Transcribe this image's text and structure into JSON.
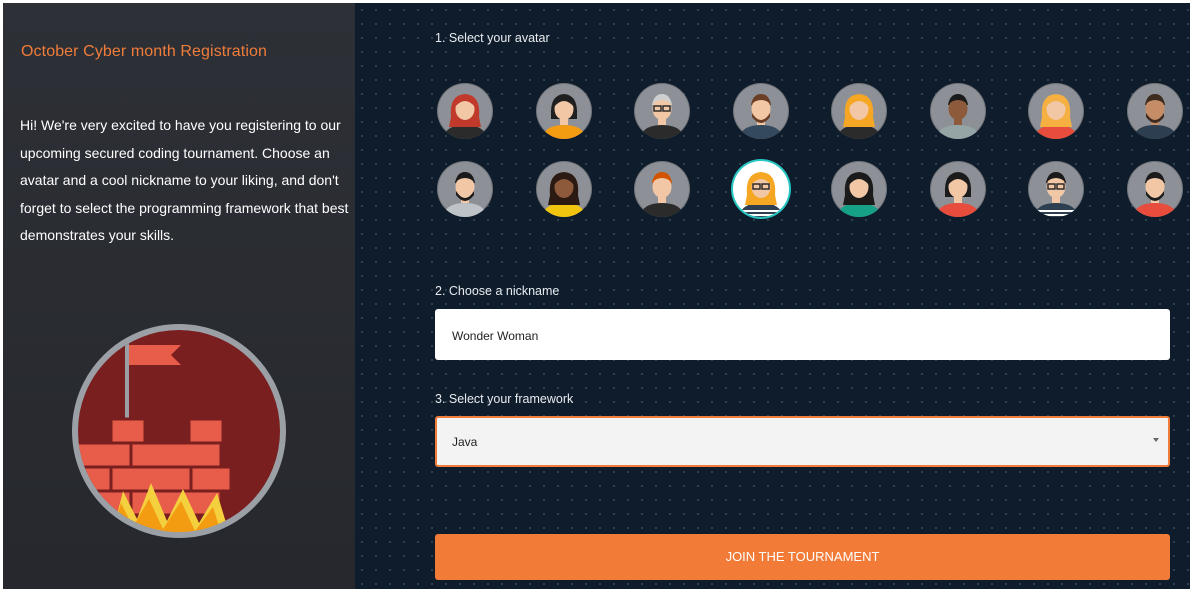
{
  "intro": {
    "title": "October Cyber month Registration",
    "text": "Hi! We're very excited to have you registering to our upcoming secured coding tournament. Choose an avatar and a cool nickname to your liking, and don't forget to select the programming framework that best demonstrates your skills."
  },
  "form": {
    "step1_label": "1. Select your avatar",
    "step2_label": "2. Choose a nickname",
    "nickname_value": "Wonder Woman",
    "step3_label": "3. Select your framework",
    "framework_selected": "Java",
    "submit_label": "JOIN THE TOURNAMENT"
  },
  "avatars": [
    {
      "id": "avatar-1",
      "hair": "#c0392b",
      "shirt": "#2b2b2b",
      "skin": "#f1c7a5",
      "style": "long",
      "selected": false
    },
    {
      "id": "avatar-2",
      "hair": "#1f1f1f",
      "shirt": "#f39c12",
      "skin": "#f1c7a5",
      "style": "bob",
      "selected": false
    },
    {
      "id": "avatar-3",
      "hair": "#cfcfcf",
      "shirt": "#2b2b2b",
      "skin": "#f1c7a5",
      "style": "short",
      "glasses": true,
      "selected": false
    },
    {
      "id": "avatar-4",
      "hair": "#6b3e26",
      "shirt": "#34495e",
      "skin": "#f1c7a5",
      "style": "beard",
      "selected": false
    },
    {
      "id": "avatar-5",
      "hair": "#f5a623",
      "shirt": "#2b2b2b",
      "skin": "#f1c7a5",
      "style": "long",
      "selected": false
    },
    {
      "id": "avatar-6",
      "hair": "#1b1b1b",
      "shirt": "#95a5a6",
      "skin": "#8d5a3b",
      "style": "short",
      "selected": false
    },
    {
      "id": "avatar-7",
      "hair": "#f5b041",
      "shirt": "#e74c3c",
      "skin": "#f1c7a5",
      "style": "long",
      "selected": false
    },
    {
      "id": "avatar-8",
      "hair": "#3d2b1f",
      "shirt": "#2c3e50",
      "skin": "#c58c68",
      "style": "beard",
      "selected": false
    },
    {
      "id": "avatar-9",
      "hair": "#1b1b1b",
      "shirt": "#bdc3c7",
      "skin": "#f1c7a5",
      "style": "beard",
      "selected": false
    },
    {
      "id": "avatar-10",
      "hair": "#2b1a12",
      "shirt": "#f1c40f",
      "skin": "#8d5a3b",
      "style": "long",
      "selected": false
    },
    {
      "id": "avatar-11",
      "hair": "#d35400",
      "shirt": "#2b2b2b",
      "skin": "#f1c7a5",
      "style": "short",
      "selected": false
    },
    {
      "id": "avatar-12",
      "hair": "#f5a623",
      "shirt": "#2c3e50",
      "skin": "#f1c7a5",
      "style": "long",
      "glasses": true,
      "stripes": true,
      "selected": true
    },
    {
      "id": "avatar-13",
      "hair": "#1b1b1b",
      "shirt": "#16a085",
      "skin": "#f1c7a5",
      "style": "long",
      "selected": false
    },
    {
      "id": "avatar-14",
      "hair": "#1b1b1b",
      "shirt": "#e74c3c",
      "skin": "#f1c7a5",
      "style": "bob",
      "selected": false
    },
    {
      "id": "avatar-15",
      "hair": "#1b1b1b",
      "shirt": "#2c3e50",
      "skin": "#f1c7a5",
      "style": "short",
      "glasses": true,
      "stripes": true,
      "selected": false
    },
    {
      "id": "avatar-16",
      "hair": "#1b1b1b",
      "shirt": "#e74c3c",
      "skin": "#f1c7a5",
      "style": "beard",
      "selected": false
    }
  ],
  "colors": {
    "accent": "#f27b38",
    "title": "#f07c3a",
    "left_bg": "#2b2e33",
    "right_bg": "#0f1c2b",
    "selected_ring": "#27c6c2"
  }
}
